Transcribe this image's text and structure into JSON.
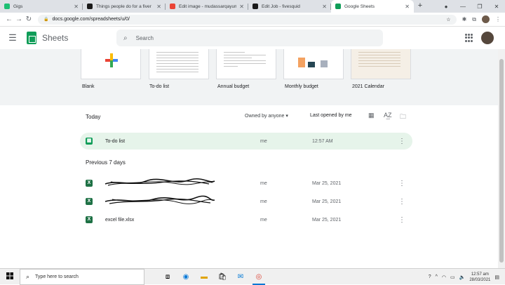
{
  "browser": {
    "tabs": [
      {
        "title": "Gigs",
        "favicon_color": "#1dbf73",
        "active": false
      },
      {
        "title": "Things people do for a fiver",
        "favicon_color": "#1a1a1a",
        "active": false
      },
      {
        "title": "Edit image - mudassarqayum",
        "favicon_color": "#ea4335",
        "active": false
      },
      {
        "title": "Edit Job - fivesquid",
        "favicon_color": "#1a1a1a",
        "active": false
      },
      {
        "title": "Google Sheets",
        "favicon_color": "#0f9d58",
        "active": true
      }
    ],
    "new_tab": "+",
    "url": "docs.google.com/spreadsheets/u/0/"
  },
  "app": {
    "name": "Sheets",
    "search_placeholder": "Search"
  },
  "templates": [
    {
      "label": "Blank"
    },
    {
      "label": "To-do list"
    },
    {
      "label": "Annual budget"
    },
    {
      "label": "Monthly budget"
    },
    {
      "label": "2021 Calendar"
    }
  ],
  "files_header": {
    "today": "Today",
    "owned_by": "Owned by anyone",
    "last_opened": "Last opened by me"
  },
  "today_files": [
    {
      "name": "To-do list",
      "owner": "me",
      "date": "12:57 AM",
      "type": "sheet"
    }
  ],
  "section_previous": "Previous 7 days",
  "previous_files": [
    {
      "name": "...xlsx",
      "owner": "me",
      "date": "Mar 25, 2021",
      "type": "excel",
      "redacted": true
    },
    {
      "name": "...xlsx",
      "owner": "me",
      "date": "Mar 25, 2021",
      "type": "excel",
      "redacted": true
    },
    {
      "name": "excel file.xlsx",
      "owner": "me",
      "date": "Mar 25, 2021",
      "type": "excel",
      "redacted": false
    }
  ],
  "taskbar": {
    "search_placeholder": "Type here to search",
    "time": "12:57 am",
    "date": "28/03/2021"
  },
  "colors": {
    "sheets_green": "#0f9d58",
    "excel_green": "#1e7145",
    "selected_row": "#e6f4ea"
  }
}
